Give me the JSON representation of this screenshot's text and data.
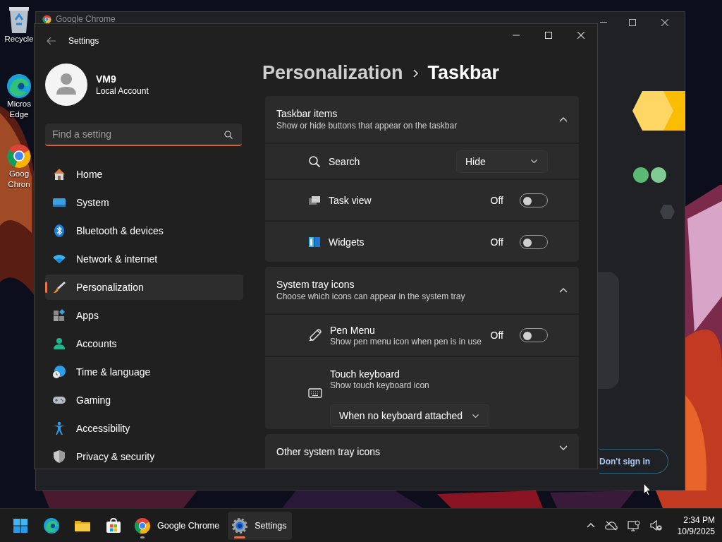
{
  "desktop": {
    "icons": [
      {
        "lines": [
          "Recycle"
        ]
      },
      {
        "lines": [
          "Micros",
          "Edge"
        ]
      },
      {
        "lines": [
          "Goog",
          "Chron"
        ]
      }
    ]
  },
  "chrome_window": {
    "title": "Google Chrome",
    "button": "Don't sign in"
  },
  "settings": {
    "title": "Settings",
    "user": {
      "name": "VM9",
      "account": "Local Account"
    },
    "search": {
      "placeholder": "Find a setting"
    },
    "nav": [
      {
        "label": "Home",
        "selected": false
      },
      {
        "label": "System",
        "selected": false
      },
      {
        "label": "Bluetooth & devices",
        "selected": false
      },
      {
        "label": "Network & internet",
        "selected": false
      },
      {
        "label": "Personalization",
        "selected": true
      },
      {
        "label": "Apps",
        "selected": false
      },
      {
        "label": "Accounts",
        "selected": false
      },
      {
        "label": "Time & language",
        "selected": false
      },
      {
        "label": "Gaming",
        "selected": false
      },
      {
        "label": "Accessibility",
        "selected": false
      },
      {
        "label": "Privacy & security",
        "selected": false
      }
    ],
    "breadcrumb": {
      "parent": "Personalization",
      "current": "Taskbar"
    },
    "sections": [
      {
        "title": "Taskbar items",
        "description": "Show or hide buttons that appear on the taskbar",
        "expanded": true,
        "rows": [
          {
            "kind": "dropdown",
            "label": "Search",
            "value": "Hide"
          },
          {
            "kind": "toggle",
            "label": "Task view",
            "state_text": "Off",
            "on": false
          },
          {
            "kind": "toggle",
            "label": "Widgets",
            "state_text": "Off",
            "on": false
          }
        ]
      },
      {
        "title": "System tray icons",
        "description": "Choose which icons can appear in the system tray",
        "expanded": true,
        "rows": [
          {
            "kind": "toggle",
            "label": "Pen Menu",
            "description": "Show pen menu icon when pen is in use",
            "state_text": "Off",
            "on": false
          },
          {
            "kind": "select",
            "label": "Touch keyboard",
            "description": "Show touch keyboard icon",
            "value": "When no keyboard attached"
          }
        ]
      },
      {
        "title": "Other system tray icons",
        "expanded": false
      }
    ]
  },
  "taskbar": {
    "apps": [
      {
        "selected": false,
        "running": false
      },
      {
        "selected": false,
        "running": false
      },
      {
        "selected": false,
        "running": false
      },
      {
        "selected": false,
        "running": false
      },
      {
        "label": "Google Chrome",
        "selected": false,
        "running": true
      },
      {
        "label": "Settings",
        "selected": true,
        "running": true
      }
    ],
    "clock": {
      "time": "2:34 PM",
      "date": "10/9/2025"
    }
  }
}
